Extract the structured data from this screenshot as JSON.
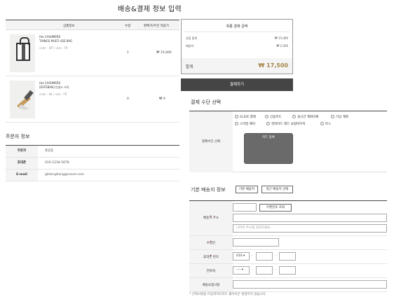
{
  "page": {
    "title": "배송&결제 정보 입력"
  },
  "products": {
    "headers": [
      "상품정보",
      "수량",
      "판매가/주문 적용가"
    ],
    "items": [
      {
        "brand": "the CASHMERE",
        "name": "THINGS MULTI USE BAG",
        "option": "color : WT / size : FR",
        "qty": "1",
        "price": "₩ 15,000"
      },
      {
        "brand": "the CASHMERE",
        "name": "[ESTEBAN] 인센스 스틱",
        "option": "color : NL / size : FR",
        "qty": "0",
        "price": "₩ 0"
      }
    ]
  },
  "summary": {
    "title": "최종 결제 금액",
    "product_total_label": "상품 합계",
    "product_total_value": "₩ 15,000",
    "shipping_label": "배송비",
    "shipping_value": "₩ 2,500",
    "total_label": "합계",
    "total_value": "₩ 17,500",
    "pay_button": "결제하기"
  },
  "orderer": {
    "title": "주문자 정보",
    "rows": [
      {
        "label": "주문자",
        "value": "홍길동"
      },
      {
        "label": "휴대폰",
        "value": "010-1234-5678"
      },
      {
        "label": "E-mail",
        "value": "gildonghong@naver.com"
      }
    ]
  },
  "payment": {
    "title": "결제 수단 선택",
    "label": "결제수단 선택",
    "options_row1": [
      "CLICK 결제",
      "신용카드",
      "실시간 계좌이체",
      "가상 계좌"
    ],
    "options_row2": [
      "스마일 페이",
      "현대카드 레드 쇼핑바우처",
      "토스"
    ],
    "card_label": "카드 등록"
  },
  "shipping": {
    "title": "기본 배송지 정보",
    "default_button": "기본 배송지",
    "recent_button": "최근 배송지 선택",
    "address_label": "배송지 주소",
    "zip_button": "우편번호 조회",
    "address_detail_placeholder": "나머지 주소를 입력하세요.",
    "recipient_label": "수령인",
    "mobile_label": "휴대폰 번호",
    "mobile_prefix": "010",
    "phone_label": "연락처",
    "phone_prefix": "----",
    "request_label": "배송요청사항",
    "note": "* 선택사항을 미입력하더라도 불이익은 발생하지 않습니다."
  },
  "colors": {
    "accent": "#a7864b",
    "button_dark": "#454545",
    "header_bg": "#f4f4f4"
  }
}
